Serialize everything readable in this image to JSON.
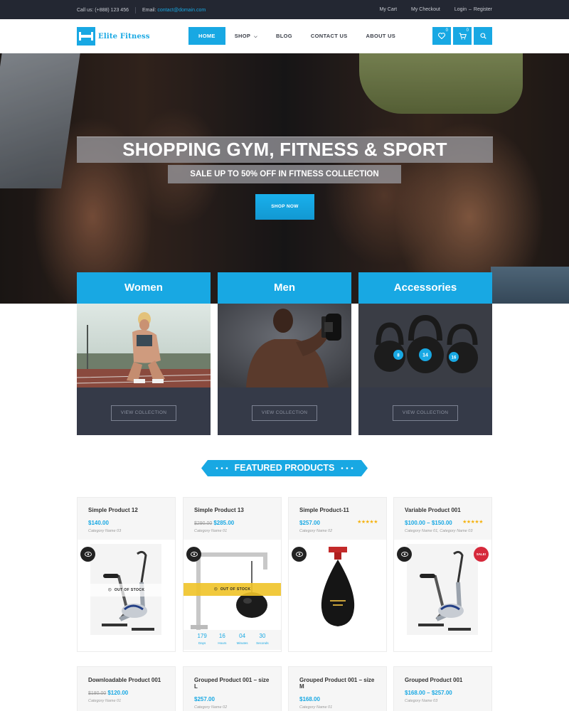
{
  "topbar": {
    "call_label": "Call us:",
    "phone": "(+888) 123 456",
    "email_label": "Email:",
    "email": "contact@domain.com",
    "links": [
      "My Cart",
      "My Checkout",
      "Login",
      "Register"
    ],
    "login_register_sep": "–"
  },
  "header": {
    "logo_text": "Elite Fitness",
    "nav": [
      {
        "label": "HOME",
        "active": true
      },
      {
        "label": "SHOP",
        "caret": true
      },
      {
        "label": "BLOG"
      },
      {
        "label": "CONTACT US"
      },
      {
        "label": "ABOUT US"
      }
    ],
    "wishlist_count": "0",
    "cart_count": "0",
    "brand_color": "#18a8e3"
  },
  "hero": {
    "title": "SHOPPING GYM, FITNESS & SPORT",
    "subtitle": "SALE UP TO 50% OFF IN FITNESS COLLECTION",
    "button": "SHOP NOW"
  },
  "collections": [
    {
      "title": "Women",
      "button": "VIEW COLLECTION"
    },
    {
      "title": "Men",
      "button": "VIEW COLLECTION"
    },
    {
      "title": "Accessories",
      "button": "VIEW COLLECTION"
    }
  ],
  "kettlebell_labels": [
    "8",
    "14",
    "16"
  ],
  "featured_title": "FEATURED PRODUCTS",
  "products_row1": [
    {
      "name": "Simple Product 12",
      "price": "$140.00",
      "old_price": "",
      "category": "Category Name 03",
      "badge": "OUT OF STOCK"
    },
    {
      "name": "Simple Product 13",
      "old_price": "$290.00",
      "price": "$285.00",
      "category": "Category Name 01",
      "badge": "OUT OF STOCK",
      "countdown": [
        {
          "n": "179",
          "l": "Days"
        },
        {
          "n": "16",
          "l": "Hours"
        },
        {
          "n": "04",
          "l": "Minutes"
        },
        {
          "n": "30",
          "l": "Seconds"
        }
      ]
    },
    {
      "name": "Simple Product-11",
      "price": "$257.00",
      "category": "Category Name 02",
      "rating": 5,
      "stars": "★★★★★"
    },
    {
      "name": "Variable Product 001",
      "price": "$100.00 – $150.00",
      "category": "Category Name 01, Category Name 03",
      "rating": 5,
      "stars": "★★★★★",
      "sale": "SALE!"
    }
  ],
  "products_row2": [
    {
      "name": "Downloadable Product 001",
      "old_price": "$180.00",
      "price": "$120.00",
      "category": "Category Name 01"
    },
    {
      "name": "Grouped Product 001 – size L",
      "price": "$257.00",
      "category": "Category Name 02"
    },
    {
      "name": "Grouped Product 001 – size M",
      "price": "$168.00",
      "category": "Category Name 01"
    },
    {
      "name": "Grouped Product 001",
      "price": "$168.00 – $257.00",
      "category": "Category Name 03"
    }
  ]
}
